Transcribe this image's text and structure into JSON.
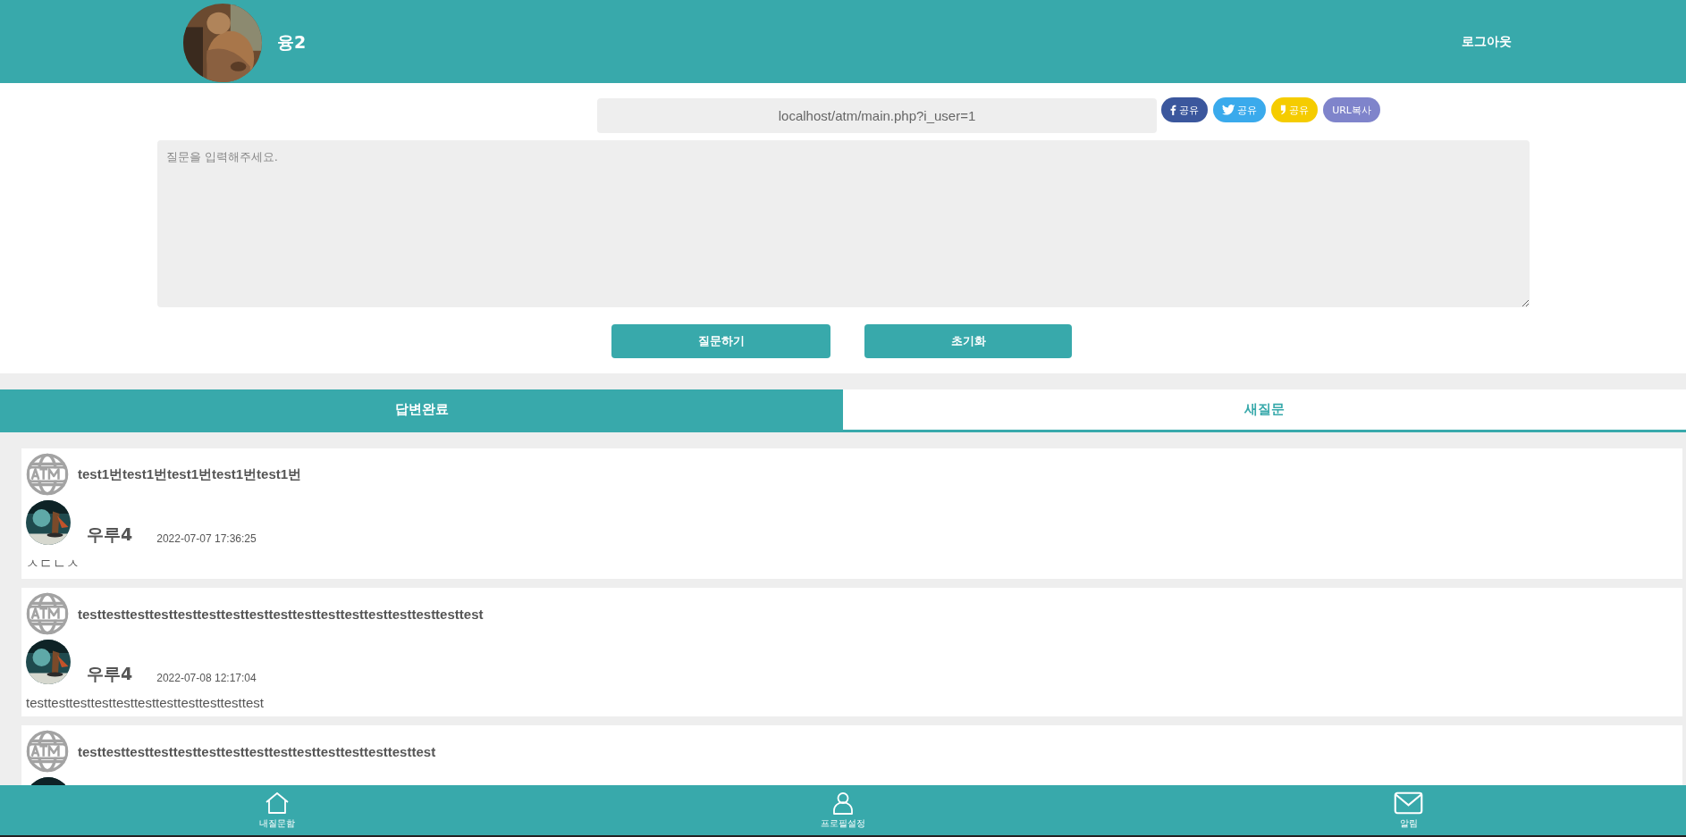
{
  "header": {
    "user_name": "융2",
    "logout": "로그아웃"
  },
  "share": {
    "url": "localhost/atm/main.php?i_user=1",
    "buttons": [
      {
        "kind": "facebook",
        "label": "공유"
      },
      {
        "kind": "twitter",
        "label": "공유"
      },
      {
        "kind": "kakao",
        "label": "공유"
      },
      {
        "kind": "copy",
        "label": "URL복사"
      }
    ]
  },
  "question": {
    "placeholder": "질문을 입력해주세요.",
    "buttons": [
      "질문하기",
      "초기화"
    ]
  },
  "tabs": [
    {
      "label": "답변완료",
      "selected": true
    },
    {
      "label": "새질문",
      "selected": false
    }
  ],
  "cards": [
    {
      "title": "test1번test1번test1번test1번test1번",
      "author": "우루4",
      "date": "2022-07-07 17:36:25",
      "body": "ㅅㄷㄴㅅ"
    },
    {
      "title": "testtesttesttesttesttesttesttesttesttesttesttesttesttesttesttesttest",
      "author": "우루4",
      "date": "2022-07-08 12:17:04",
      "body": "testtesttesttesttesttesttesttesttesttesttest"
    },
    {
      "title": "testtesttesttesttesttesttesttesttesttesttesttesttesttesttest"
    }
  ],
  "bottom_nav": [
    {
      "kind": "home",
      "label": "내질문함"
    },
    {
      "kind": "profile",
      "label": "프로필설정"
    },
    {
      "kind": "mail",
      "label": "알림"
    }
  ]
}
